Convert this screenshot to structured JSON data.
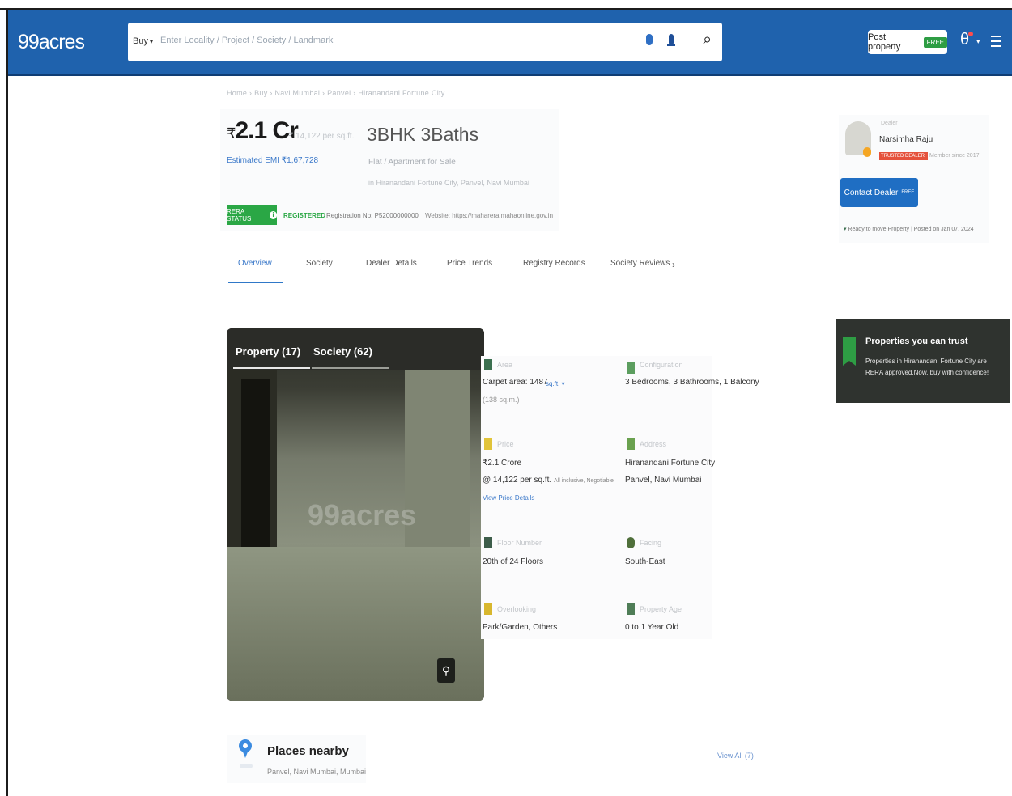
{
  "header": {
    "logo": "99acres",
    "search": {
      "mode_label": "Buy",
      "placeholder": "Enter Locality / Project / Society / Landmark"
    },
    "post_property_label": "Post property",
    "post_property_badge": "FREE"
  },
  "listing": {
    "breadcrumb": "Home › Buy › Navi Mumbai › Panvel › Hiranandani Fortune City",
    "price_symbol": "₹",
    "price": "2.1 Cr",
    "price_note": "₹ 14,122 per sq.ft.",
    "config_title": "3BHK 3Baths",
    "emi": "Estimated EMI ₹1,67,728",
    "subtype": "Flat / Apartment for Sale",
    "sub_location": "in Hiranandani Fortune City, Panvel, Navi Mumbai",
    "rera": {
      "status_label": "RERA STATUS",
      "registered": "REGISTERED",
      "reg_no": "Registration No: P52000000000",
      "website": "Website: https://maharera.mahaonline.gov.in"
    }
  },
  "tabs": [
    {
      "label": "Overview",
      "active": true
    },
    {
      "label": "Society"
    },
    {
      "label": "Dealer Details"
    },
    {
      "label": "Price Trends"
    },
    {
      "label": "Registry Records"
    },
    {
      "label": "Society Reviews"
    }
  ],
  "gallery": {
    "tab_property": "Property (17)",
    "tab_society": "Society (62)",
    "watermark": "99acres"
  },
  "details": {
    "area": {
      "label": "Area",
      "value": "Carpet area: 1487",
      "unit": "sq.ft.",
      "sub": "(138 sq.m.)"
    },
    "configuration": {
      "label": "Configuration",
      "value": "3 Bedrooms, 3 Bathrooms, 1 Balcony"
    },
    "price": {
      "label": "Price",
      "value": "₹2.1 Crore",
      "sub": "@ 14,122 per sq.ft.",
      "sub_note": "All inclusive, Negotiable",
      "link": "View Price Details"
    },
    "address": {
      "label": "Address",
      "value": "Hiranandani Fortune City",
      "sub": "Panvel, Navi Mumbai"
    },
    "floor": {
      "label": "Floor Number",
      "value": "20th of 24 Floors"
    },
    "facing": {
      "label": "Facing",
      "value": "South-East"
    },
    "overlooking": {
      "label": "Overlooking",
      "value": "Park/Garden, Others"
    },
    "property_age": {
      "label": "Property Age",
      "value": "0 to 1 Year Old"
    }
  },
  "dealer": {
    "role": "Dealer",
    "name": "Narsimha Raju",
    "tag": "TRUSTED DEALER",
    "tag_note": "Member since 2017",
    "contact_label": "Contact Dealer",
    "contact_badge": "FREE",
    "ready_status": "Ready to move Property",
    "posted": "Posted on Jan 07, 2024"
  },
  "trust": {
    "title": "Properties you can trust",
    "text": "Properties in Hiranandani Fortune City are RERA approved.Now, buy with confidence!"
  },
  "places": {
    "title": "Places nearby",
    "subtitle": "Panvel, Navi Mumbai, Mumbai",
    "view_all": "View All (7)"
  },
  "colors": {
    "header_bg": "#1f62ad",
    "accent_blue": "#3a78c9",
    "green": "#2aa745",
    "trust_bg": "#2f332f"
  }
}
